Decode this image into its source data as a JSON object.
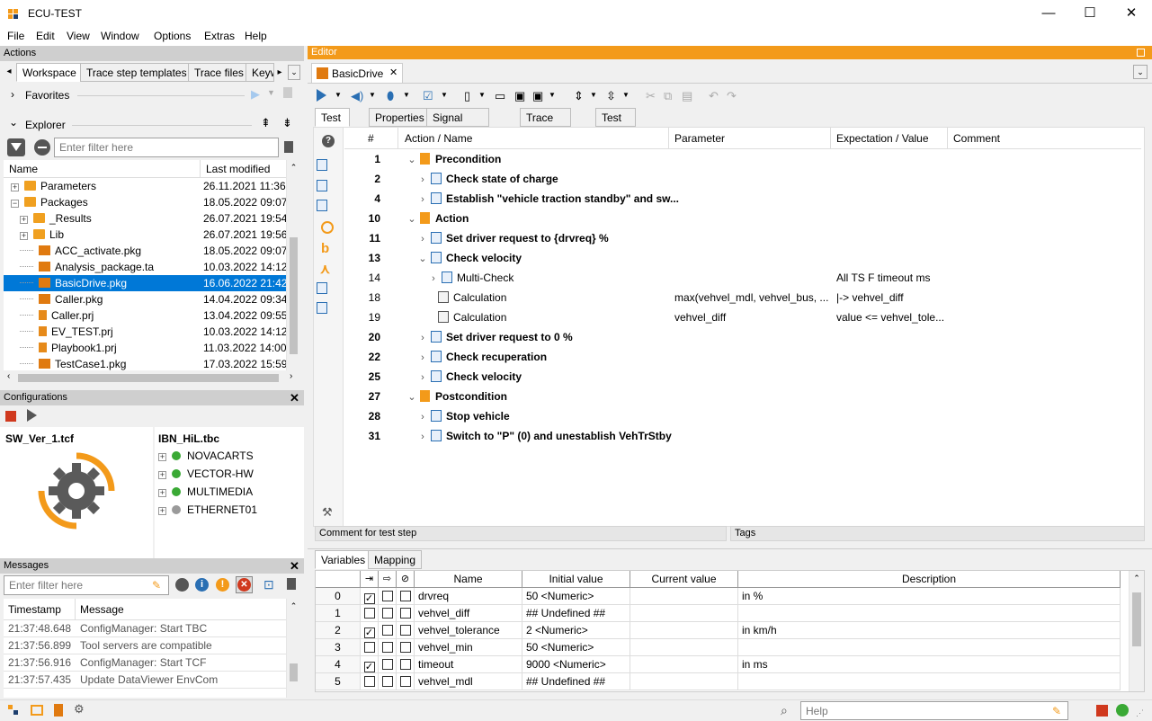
{
  "app": {
    "title": "ECU-TEST",
    "min": "—",
    "max": "☐",
    "close": "✕"
  },
  "menu": [
    "File",
    "Edit",
    "View",
    "Window",
    "Options",
    "Extras",
    "Help"
  ],
  "actions": {
    "title": "Actions",
    "tabs": [
      "Workspace",
      "Trace step templates",
      "Trace files",
      "Keyw"
    ],
    "favorites": "Favorites",
    "explorer": "Explorer",
    "filter_placeholder": "Enter filter here",
    "col_name": "Name",
    "col_modified": "Last modified",
    "rows": [
      {
        "name": "Parameters",
        "date": "26.11.2021 11:36",
        "icon": "folder-icon",
        "indent": 0,
        "exp": "+"
      },
      {
        "name": "Packages",
        "date": "18.05.2022 09:07",
        "icon": "folder-icon",
        "indent": 0,
        "exp": "−"
      },
      {
        "name": "_Results",
        "date": "26.07.2021 19:54",
        "icon": "folder-icon",
        "indent": 1,
        "exp": "+"
      },
      {
        "name": "Lib",
        "date": "26.07.2021 19:56",
        "icon": "folder-icon",
        "indent": 1,
        "exp": "+"
      },
      {
        "name": "ACC_activate.pkg",
        "date": "18.05.2022 09:07",
        "icon": "package-icon",
        "indent": 1,
        "exp": ""
      },
      {
        "name": "Analysis_package.ta",
        "date": "10.03.2022 14:12",
        "icon": "analysis-icon",
        "indent": 1,
        "exp": ""
      },
      {
        "name": "BasicDrive.pkg",
        "date": "16.06.2022 21:42",
        "icon": "package-icon",
        "indent": 1,
        "exp": "",
        "selected": true
      },
      {
        "name": "Caller.pkg",
        "date": "14.04.2022 09:34",
        "icon": "package-icon",
        "indent": 1,
        "exp": ""
      },
      {
        "name": "Caller.prj",
        "date": "13.04.2022 09:55",
        "icon": "project-icon",
        "indent": 1,
        "exp": ""
      },
      {
        "name": "EV_TEST.prj",
        "date": "10.03.2022 14:12",
        "icon": "project-icon",
        "indent": 1,
        "exp": ""
      },
      {
        "name": "Playbook1.prj",
        "date": "11.03.2022 14:00",
        "icon": "project-icon",
        "indent": 1,
        "exp": ""
      },
      {
        "name": "TestCase1.pkg",
        "date": "17.03.2022 15:59",
        "icon": "package-icon",
        "indent": 1,
        "exp": ""
      }
    ]
  },
  "configurations": {
    "title": "Configurations",
    "tcf": "SW_Ver_1.tcf",
    "tbc": "IBN_HiL.tbc",
    "items": [
      {
        "label": "NOVACARTS",
        "status": "#3aa935"
      },
      {
        "label": "VECTOR-HW",
        "status": "#3aa935"
      },
      {
        "label": "MULTIMEDIA",
        "status": "#3aa935"
      },
      {
        "label": "ETHERNET01",
        "status": "#9a9a9a"
      }
    ]
  },
  "messages": {
    "title": "Messages",
    "filter_placeholder": "Enter filter here",
    "col_timestamp": "Timestamp",
    "col_message": "Message",
    "rows": [
      {
        "ts": "21:37:48.648",
        "msg": "ConfigManager: Start TBC"
      },
      {
        "ts": "21:37:56.899",
        "msg": "Tool servers are compatible"
      },
      {
        "ts": "21:37:56.916",
        "msg": "ConfigManager: Start TCF"
      },
      {
        "ts": "21:37:57.435",
        "msg": "Update DataViewer EnvCom"
      }
    ]
  },
  "editor": {
    "title": "Editor",
    "doc_tab": "BasicDrive",
    "doc_close": "✕",
    "subtabs": [
      "Test case",
      "Properties",
      "Signal recordings",
      "Trace analysis",
      "Test report"
    ],
    "cols": {
      "num": "#",
      "name": "Action / Name",
      "param": "Parameter",
      "expect": "Expectation / Value",
      "comment": "Comment"
    },
    "steps": [
      {
        "num": "1",
        "name": "Precondition",
        "bold": true,
        "level": 0,
        "chev": "⌄",
        "icon": "block-icon",
        "param": "",
        "expect": ""
      },
      {
        "num": "2",
        "name": "Check state of charge",
        "bold": true,
        "level": 1,
        "chev": "›",
        "icon": "step-icon",
        "param": "",
        "expect": ""
      },
      {
        "num": "4",
        "name": "Establish \"vehicle traction standby\" and sw...",
        "bold": true,
        "level": 1,
        "chev": "›",
        "icon": "step-icon",
        "param": "",
        "expect": ""
      },
      {
        "num": "10",
        "name": "Action",
        "bold": true,
        "level": 0,
        "chev": "⌄",
        "icon": "block-icon",
        "param": "",
        "expect": ""
      },
      {
        "num": "11",
        "name": "Set driver request to {drvreq} %",
        "bold": true,
        "level": 1,
        "chev": "›",
        "icon": "step-icon",
        "param": "",
        "expect": ""
      },
      {
        "num": "13",
        "name": "Check velocity",
        "bold": true,
        "level": 1,
        "chev": "⌄",
        "icon": "step-icon",
        "param": "",
        "expect": ""
      },
      {
        "num": "14",
        "name": "Multi-Check",
        "bold": false,
        "level": 2,
        "chev": "›",
        "icon": "check-icon",
        "param": "",
        "expect": "All TS F timeout ms"
      },
      {
        "num": "18",
        "name": "Calculation",
        "bold": false,
        "level": 3,
        "chev": "",
        "icon": "calc-icon",
        "param": "max(vehvel_mdl, vehvel_bus, ...",
        "expect": "|-> vehvel_diff"
      },
      {
        "num": "19",
        "name": "Calculation",
        "bold": false,
        "level": 3,
        "chev": "",
        "icon": "calc-icon",
        "param": "vehvel_diff",
        "expect": "value <= vehvel_tole..."
      },
      {
        "num": "20",
        "name": "Set driver request to 0 %",
        "bold": true,
        "level": 1,
        "chev": "›",
        "icon": "step-icon",
        "param": "",
        "expect": ""
      },
      {
        "num": "22",
        "name": "Check recuperation",
        "bold": true,
        "level": 1,
        "chev": "›",
        "icon": "step-icon",
        "param": "",
        "expect": ""
      },
      {
        "num": "25",
        "name": "Check velocity",
        "bold": true,
        "level": 1,
        "chev": "›",
        "icon": "step-icon",
        "param": "",
        "expect": ""
      },
      {
        "num": "27",
        "name": "Postcondition",
        "bold": true,
        "level": 0,
        "chev": "⌄",
        "icon": "block-icon",
        "param": "",
        "expect": ""
      },
      {
        "num": "28",
        "name": "Stop vehicle",
        "bold": true,
        "level": 1,
        "chev": "›",
        "icon": "step-icon",
        "param": "",
        "expect": ""
      },
      {
        "num": "31",
        "name": "Switch to \"P\" (0) and unestablish VehTrStby",
        "bold": true,
        "level": 1,
        "chev": "›",
        "icon": "step-icon",
        "param": "",
        "expect": ""
      }
    ],
    "comment_label": "Comment for test step",
    "tags_label": "Tags",
    "vartabs": [
      "Variables",
      "Mapping"
    ],
    "var_cols": {
      "name": "Name",
      "initial": "Initial value",
      "current": "Current value",
      "desc": "Description"
    },
    "vars": [
      {
        "idx": "0",
        "c1": true,
        "c2": false,
        "c3": false,
        "name": "drvreq",
        "initial": "50 <Numeric>",
        "current": "",
        "desc": "in %"
      },
      {
        "idx": "1",
        "c1": false,
        "c2": false,
        "c3": false,
        "name": "vehvel_diff",
        "initial": "## Undefined ##",
        "current": "",
        "desc": ""
      },
      {
        "idx": "2",
        "c1": true,
        "c2": false,
        "c3": false,
        "name": "vehvel_tolerance",
        "initial": "2 <Numeric>",
        "current": "",
        "desc": "in km/h"
      },
      {
        "idx": "3",
        "c1": false,
        "c2": false,
        "c3": false,
        "name": "vehvel_min",
        "initial": "50 <Numeric>",
        "current": "",
        "desc": ""
      },
      {
        "idx": "4",
        "c1": true,
        "c2": false,
        "c3": false,
        "name": "timeout",
        "initial": "9000 <Numeric>",
        "current": "",
        "desc": "in ms"
      },
      {
        "idx": "5",
        "c1": false,
        "c2": false,
        "c3": false,
        "name": "vehvel_mdl",
        "initial": "## Undefined ##",
        "current": "",
        "desc": ""
      }
    ]
  },
  "status": {
    "help_placeholder": "Help"
  },
  "colors": {
    "accent": "#f39a1a",
    "selection": "#0078d7",
    "brand_blue": "#2a6fb3"
  }
}
